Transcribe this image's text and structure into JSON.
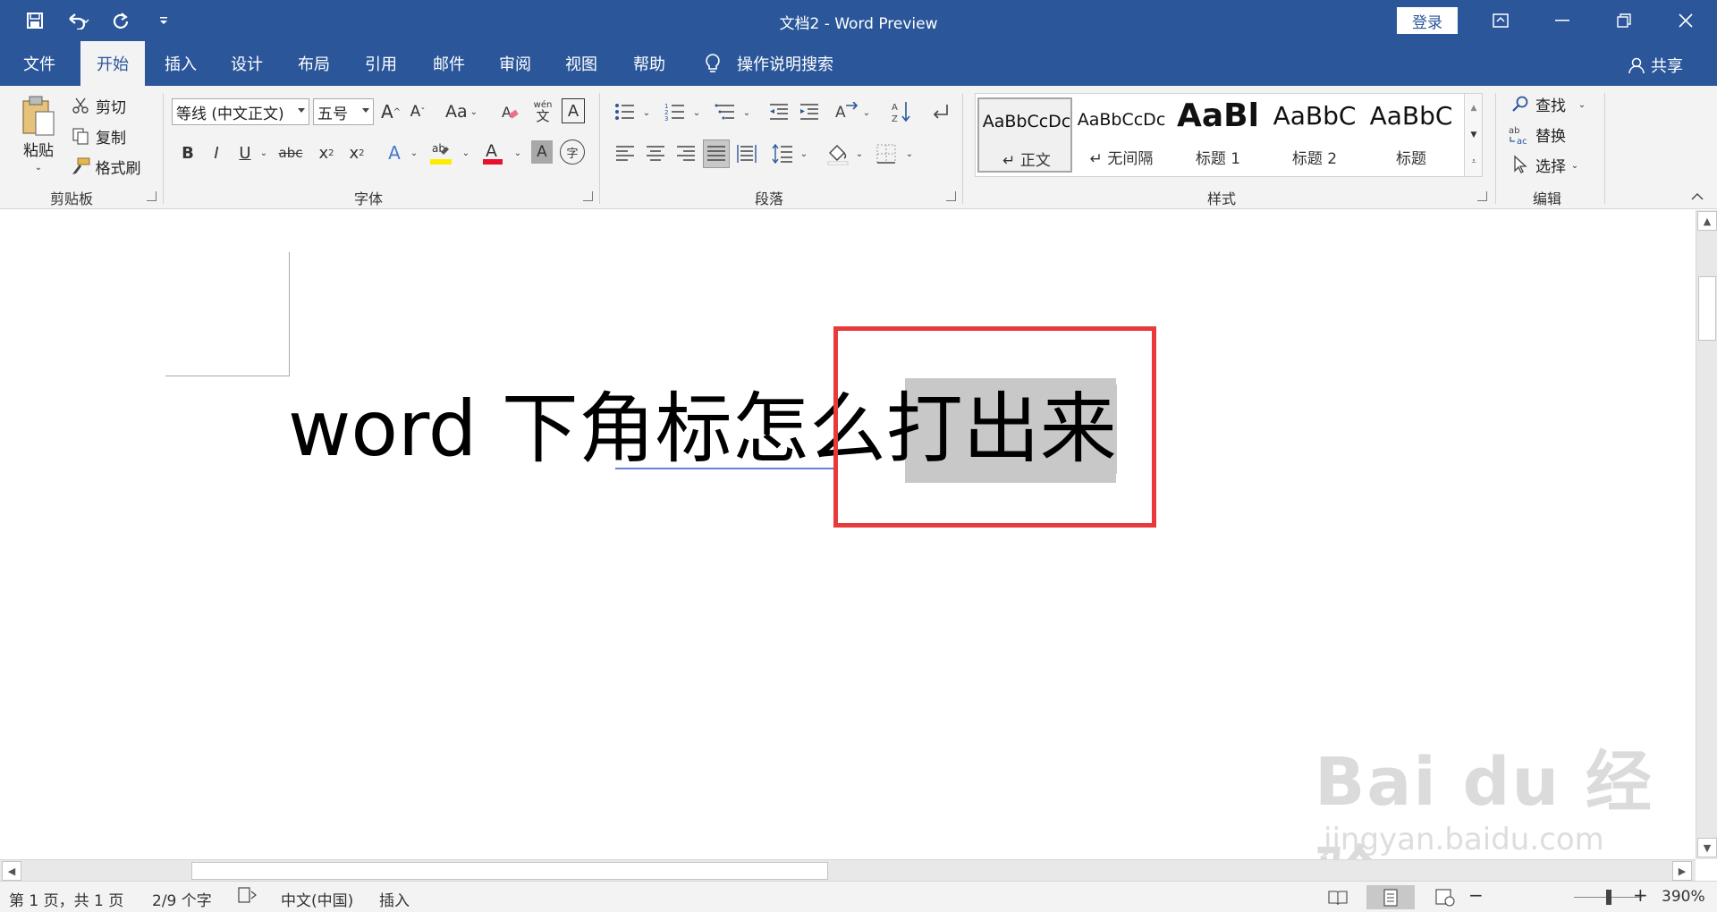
{
  "window": {
    "title": "文档2  -  Word Preview",
    "login_label": "登录"
  },
  "tabs": [
    {
      "label": "文件",
      "active": false
    },
    {
      "label": "开始",
      "active": true
    },
    {
      "label": "插入",
      "active": false
    },
    {
      "label": "设计",
      "active": false
    },
    {
      "label": "布局",
      "active": false
    },
    {
      "label": "引用",
      "active": false
    },
    {
      "label": "邮件",
      "active": false
    },
    {
      "label": "审阅",
      "active": false
    },
    {
      "label": "视图",
      "active": false
    },
    {
      "label": "帮助",
      "active": false
    }
  ],
  "tell_me": "操作说明搜索",
  "share_label": "共享",
  "ribbon": {
    "clipboard": {
      "label": "剪贴板",
      "paste": "粘贴",
      "cut": "剪切",
      "copy": "复制",
      "format_painter": "格式刷"
    },
    "font": {
      "label": "字体",
      "font_name": "等线 (中文正文)",
      "font_size": "五号",
      "change_case": "Aa",
      "bold": "B",
      "italic": "I",
      "underline": "U",
      "strike": "abc",
      "pinyin_top": "wén",
      "pinyin_bottom": "文",
      "enclose": "字"
    },
    "paragraph": {
      "label": "段落"
    },
    "styles": {
      "label": "样式",
      "items": [
        {
          "preview": "AaBbCcDc",
          "name": "↵ 正文",
          "selected": true
        },
        {
          "preview": "AaBbCcDc",
          "name": "↵ 无间隔",
          "selected": false
        },
        {
          "preview": "AaBl",
          "name": "标题 1",
          "selected": false
        },
        {
          "preview": "AaBbC",
          "name": "标题 2",
          "selected": false
        },
        {
          "preview": "AaBbC",
          "name": "标题",
          "selected": false
        }
      ]
    },
    "editing": {
      "label": "编辑",
      "find": "查找",
      "replace": "替换",
      "select": "选择"
    }
  },
  "document": {
    "text_before": "word 下角标怎么打",
    "text_selected": "出来"
  },
  "watermark": {
    "brand": "Bai du 经验",
    "url": "jingyan.baidu.com"
  },
  "status": {
    "page": "第 1 页，共 1 页",
    "words": "2/9 个字",
    "language": "中文(中国)",
    "mode": "插入",
    "zoom": "390%"
  },
  "colors": {
    "accent": "#2b579a",
    "highlight_box": "#e8393b",
    "selection": "#c8c8c8"
  }
}
